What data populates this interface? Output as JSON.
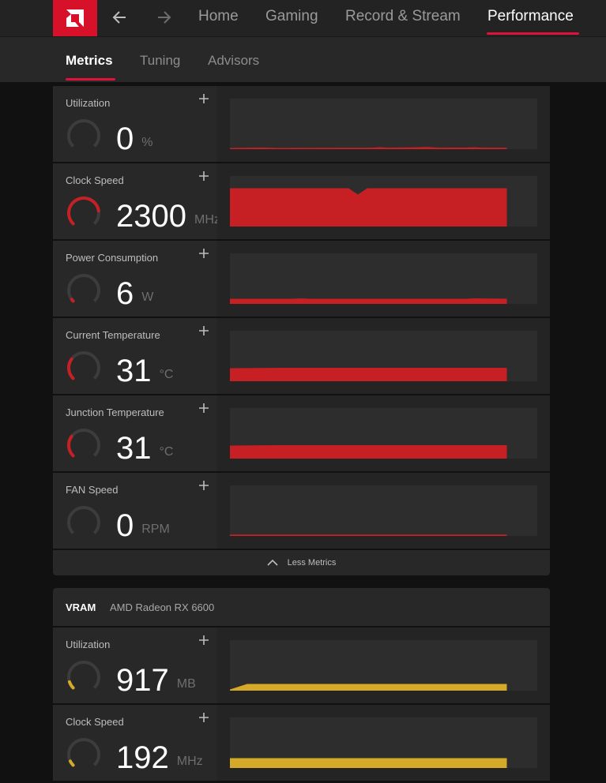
{
  "nav": {
    "items": [
      {
        "label": "Home"
      },
      {
        "label": "Gaming"
      },
      {
        "label": "Record & Stream"
      },
      {
        "label": "Performance"
      }
    ]
  },
  "subnav": {
    "items": [
      {
        "label": "Metrics"
      },
      {
        "label": "Tuning"
      },
      {
        "label": "Advisors"
      }
    ]
  },
  "gpu_metrics": [
    {
      "label": "Utilization",
      "value": "0",
      "unit": "%",
      "gauge_fraction": 0.0
    },
    {
      "label": "Clock Speed",
      "value": "2300",
      "unit": "MHz",
      "gauge_fraction": 0.8
    },
    {
      "label": "Power Consumption",
      "value": "6",
      "unit": "W",
      "gauge_fraction": 0.03
    },
    {
      "label": "Current Temperature",
      "value": "31",
      "unit": "°C",
      "gauge_fraction": 0.3
    },
    {
      "label": "Junction Temperature",
      "value": "31",
      "unit": "°C",
      "gauge_fraction": 0.3
    },
    {
      "label": "FAN Speed",
      "value": "0",
      "unit": "RPM",
      "gauge_fraction": 0.0
    }
  ],
  "less_metrics_label": "Less Metrics",
  "vram": {
    "title": "VRAM",
    "device": "AMD Radeon RX 6600",
    "metrics": [
      {
        "label": "Utilization",
        "value": "917",
        "unit": "MB",
        "gauge_fraction": 0.1
      },
      {
        "label": "Clock Speed",
        "value": "192",
        "unit": "MHz",
        "gauge_fraction": 0.07
      }
    ]
  },
  "colors": {
    "accent_red": "#e0113a",
    "gpu_graph": "#c62024",
    "vram_graph": "#d4aa28",
    "background": "#111111"
  }
}
